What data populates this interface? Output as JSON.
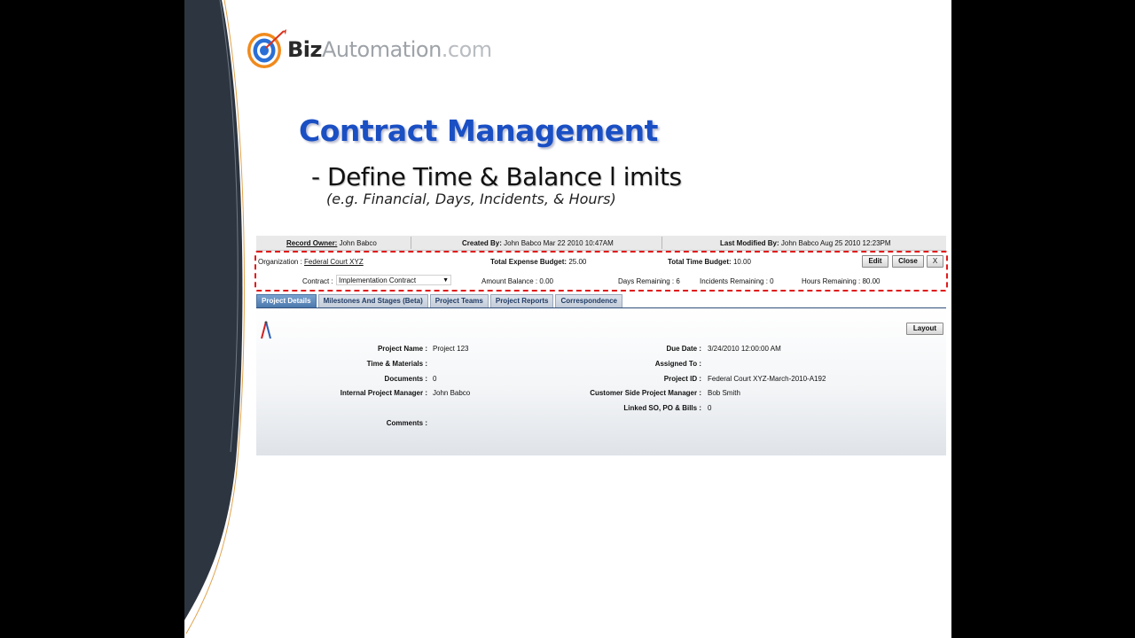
{
  "logo": {
    "biz": "Biz",
    "automation": "Automation",
    "com": ".com"
  },
  "slide": {
    "title": "Contract Management",
    "subtitle": "- Define Time & Balance l imits",
    "note": "(e.g. Financial, Days, Incidents, & Hours)"
  },
  "record_bar": {
    "owner_label": "Record Owner:",
    "owner_value": "John Babco",
    "created_label": "Created By:",
    "created_value": "John Babco Mar 22 2010 10:47AM",
    "modified_label": "Last Modified By:",
    "modified_value": "John Babco Aug 25 2010 12:23PM"
  },
  "contract_header": {
    "organization_label": "Organization :",
    "organization_value": "Federal Court XYZ",
    "expense_budget_label": "Total Expense Budget:",
    "expense_budget_value": "25.00",
    "time_budget_label": "Total Time Budget:",
    "time_budget_value": "10.00",
    "edit_label": "Edit",
    "close_label": "Close",
    "x_label": "X",
    "contract_label": "Contract :",
    "contract_value": "Implementation Contract",
    "amount_balance_label": "Amount Balance :",
    "amount_balance_value": "0.00",
    "days_remaining_label": "Days Remaining :",
    "days_remaining_value": "6",
    "incidents_remaining_label": "Incidents Remaining :",
    "incidents_remaining_value": "0",
    "hours_remaining_label": "Hours Remaining :",
    "hours_remaining_value": "80.00"
  },
  "tabs": [
    {
      "label": "Project Details",
      "active": true
    },
    {
      "label": "Milestones And Stages (Beta)",
      "active": false
    },
    {
      "label": "Project Teams",
      "active": false
    },
    {
      "label": "Project Reports",
      "active": false
    },
    {
      "label": "Correspondence",
      "active": false
    }
  ],
  "details": {
    "layout_label": "Layout",
    "icon": "pencil-compass-icon",
    "left": [
      {
        "label": "Project Name :",
        "value": "Project 123"
      },
      {
        "label": "Time & Materials :",
        "value": ""
      },
      {
        "label": "Documents :",
        "value": "0"
      },
      {
        "label": "Internal Project Manager :",
        "value": "John Babco"
      },
      {
        "label": "Comments :",
        "value": ""
      }
    ],
    "right": [
      {
        "label": "Due Date :",
        "value": "3/24/2010 12:00:00 AM"
      },
      {
        "label": "Assigned To :",
        "value": ""
      },
      {
        "label": "Project ID :",
        "value": "Federal Court XYZ-March-2010-A192"
      },
      {
        "label": "Customer Side Project Manager :",
        "value": "Bob Smith"
      },
      {
        "label": "Linked SO, PO & Bills :",
        "value": "0"
      }
    ]
  },
  "colors": {
    "title_blue": "#1a4fc4",
    "dashed_red": "#e01b1b",
    "active_tab": "#4b79ad",
    "swoosh_dark": "#2d3540",
    "swoosh_accent": "#e0a24a"
  }
}
